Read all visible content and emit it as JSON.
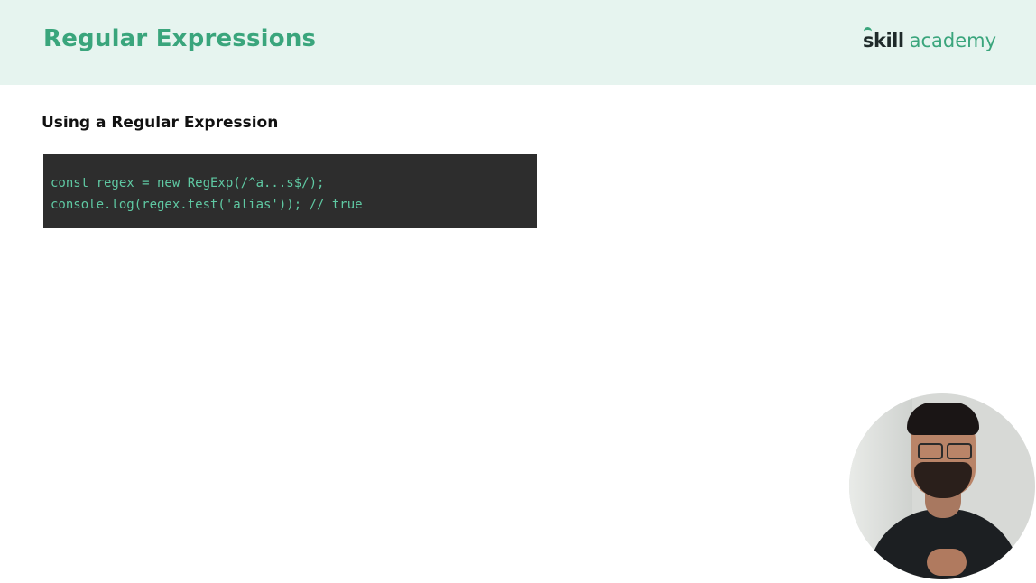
{
  "header": {
    "title": "Regular Expressions",
    "brand": {
      "part1": "skill",
      "part2": "academy"
    }
  },
  "content": {
    "heading": "Using a Regular Expression",
    "code_lines": [
      "const regex = new RegExp(/^a...s$/);",
      "console.log(regex.test('alias')); // true"
    ]
  },
  "colors": {
    "accent": "#3aa57c",
    "header_bg": "#e6f4ef",
    "code_bg": "#2d2d2d",
    "code_text": "#5fc9a3"
  }
}
